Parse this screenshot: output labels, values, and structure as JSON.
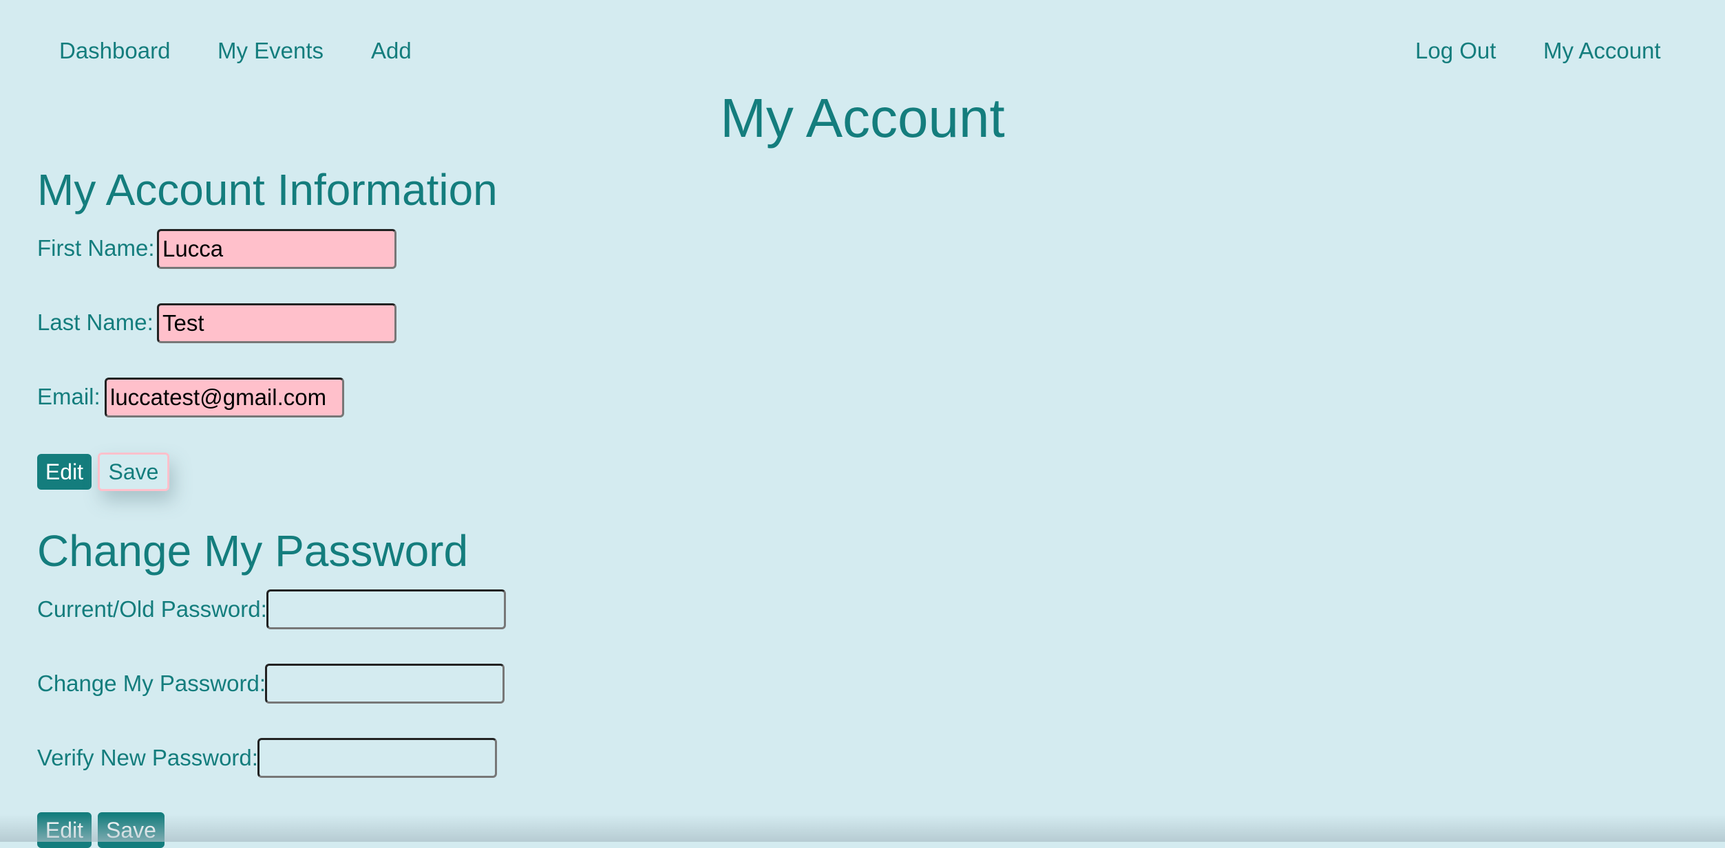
{
  "nav": {
    "left": [
      "Dashboard",
      "My Events",
      "Add"
    ],
    "right": [
      "Log Out",
      "My Account"
    ]
  },
  "page_title": "My Account",
  "account_info": {
    "title": "My Account Information",
    "first_name_label": "First Name:",
    "first_name_value": "Lucca",
    "last_name_label": "Last Name:",
    "last_name_value": "Test",
    "email_label": "Email:",
    "email_value": "luccatest@gmail.com",
    "edit_label": "Edit",
    "save_label": "Save"
  },
  "password": {
    "title": "Change My Password",
    "current_label": "Current/Old Password:",
    "current_value": "",
    "change_label": "Change My Password:",
    "change_value": "",
    "verify_label": "Verify New Password:",
    "verify_value": "",
    "edit_label": "Edit",
    "save_label": "Save"
  },
  "colors": {
    "background": "#d4ebf0",
    "accent": "#147d7d",
    "field_filled": "#ffc0cb",
    "text": "#000000"
  }
}
